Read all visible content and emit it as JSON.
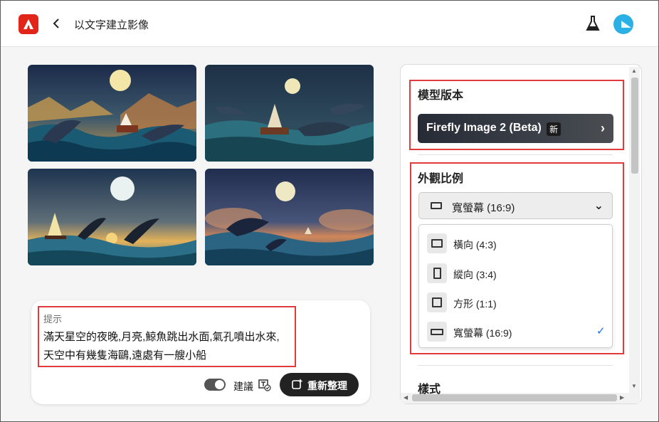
{
  "header": {
    "title": "以文字建立影像",
    "app_icon": "adobe-firefly-logo",
    "back_icon": "chevron-left-icon",
    "labs_icon": "flask-icon",
    "avatar_icon": "user-avatar"
  },
  "gallery": {
    "images": [
      {
        "name": "generated-image-1"
      },
      {
        "name": "generated-image-2"
      },
      {
        "name": "generated-image-3"
      },
      {
        "name": "generated-image-4"
      }
    ]
  },
  "prompt": {
    "label": "提示",
    "line1": "滿天星空的夜晚,月亮,鯨魚跳出水面,氣孔噴出水來,",
    "line2": "天空中有幾隻海鷗,遠處有一艘小船",
    "suggest_label": "建議",
    "toggle_on": true,
    "refine_label": "重新整理"
  },
  "panel": {
    "model_title": "模型版本",
    "model_name": "Firefly Image 2 (Beta)",
    "model_badge": "新",
    "aspect_title": "外觀比例",
    "aspect_selected": "寬螢幕 (16:9)",
    "aspect_options": [
      {
        "label": "橫向 (4:3)",
        "checked": false
      },
      {
        "label": "縱向 (3:4)",
        "checked": false
      },
      {
        "label": "方形 (1:1)",
        "checked": false
      },
      {
        "label": "寬螢幕 (16:9)",
        "checked": true
      }
    ],
    "check_mark": "✓",
    "style_title": "樣式"
  },
  "colors": {
    "highlight": "#e23b3b",
    "brand": "#e1251b",
    "accent": "#1473e6"
  }
}
